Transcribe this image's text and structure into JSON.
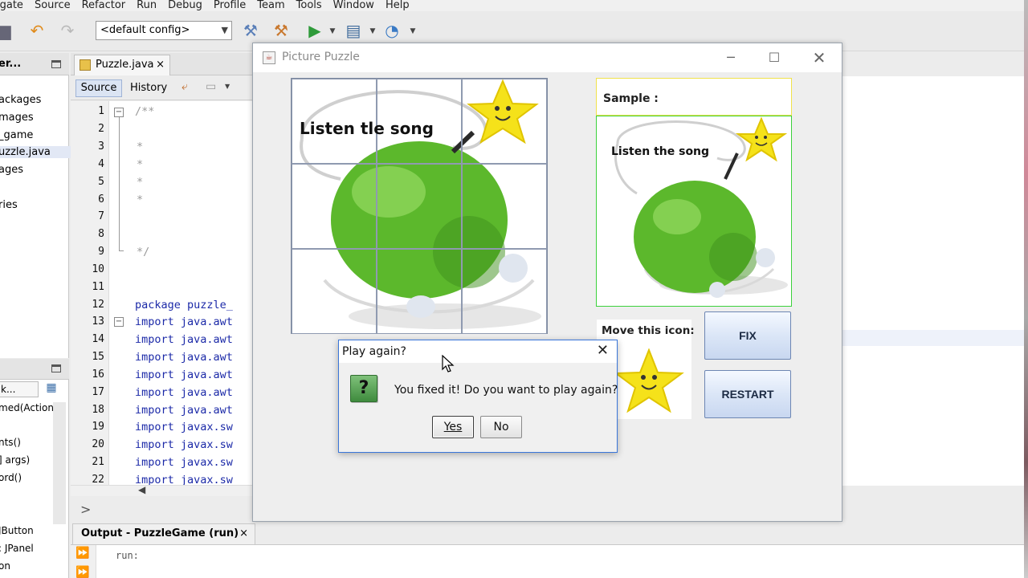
{
  "ide": {
    "menu": [
      "igate",
      "Source",
      "Refactor",
      "Run",
      "Debug",
      "Profile",
      "Team",
      "Tools",
      "Window",
      "Help"
    ],
    "config": "<default config>",
    "projects_tab": "er...",
    "project_items": [
      "ackages",
      "mages",
      "_game",
      "uzzle.java",
      "ages",
      "ries"
    ],
    "editor_tab": "Puzzle.java",
    "source_label": "Source",
    "history_label": "History",
    "line_numbers": [
      "1",
      "2",
      "3",
      "4",
      "5",
      "6",
      "7",
      "8",
      "9",
      "10",
      "11",
      "12",
      "13",
      "14",
      "15",
      "16",
      "17",
      "18",
      "19",
      "20",
      "21",
      "22"
    ],
    "code_lines": {
      "l1": "/**",
      "l3": "*",
      "l4": "*",
      "l5": "*",
      "l6": "*",
      "l9": "*/",
      "l12": "package puzzle_",
      "imports": [
        "import java.awt",
        "import java.awt",
        "import java.awt",
        "import java.awt",
        "import java.awt",
        "import java.awt",
        "import javax.sw",
        "import javax.sw",
        "import javax.sw",
        "import javax.sw"
      ]
    },
    "nav_search": "k...",
    "nav_items": [
      "med(Action",
      "nts()",
      "] args)",
      "ord()",
      "JButton",
      ": JPanel",
      "on"
    ],
    "output_tab": "Output - PuzzleGame (run)",
    "output_text": "run:"
  },
  "window": {
    "title": "Picture Puzzle",
    "sample_label": "Sample :",
    "tile_text": "Listen tle song",
    "sample_text": "Listen the song",
    "move_icon_label": "Move this icon:",
    "fix_button": "FIX",
    "restart_button": "RESTART"
  },
  "dialog": {
    "title": "Play again?",
    "message": "You fixed it! Do you want to play again?",
    "yes": "Yes",
    "no": "No",
    "icon": "question-icon"
  },
  "colors": {
    "apple": "#5cb82c",
    "star": "#f5e21a",
    "dialog_border": "#3a76d9",
    "sample_border": "#3bd13b"
  }
}
